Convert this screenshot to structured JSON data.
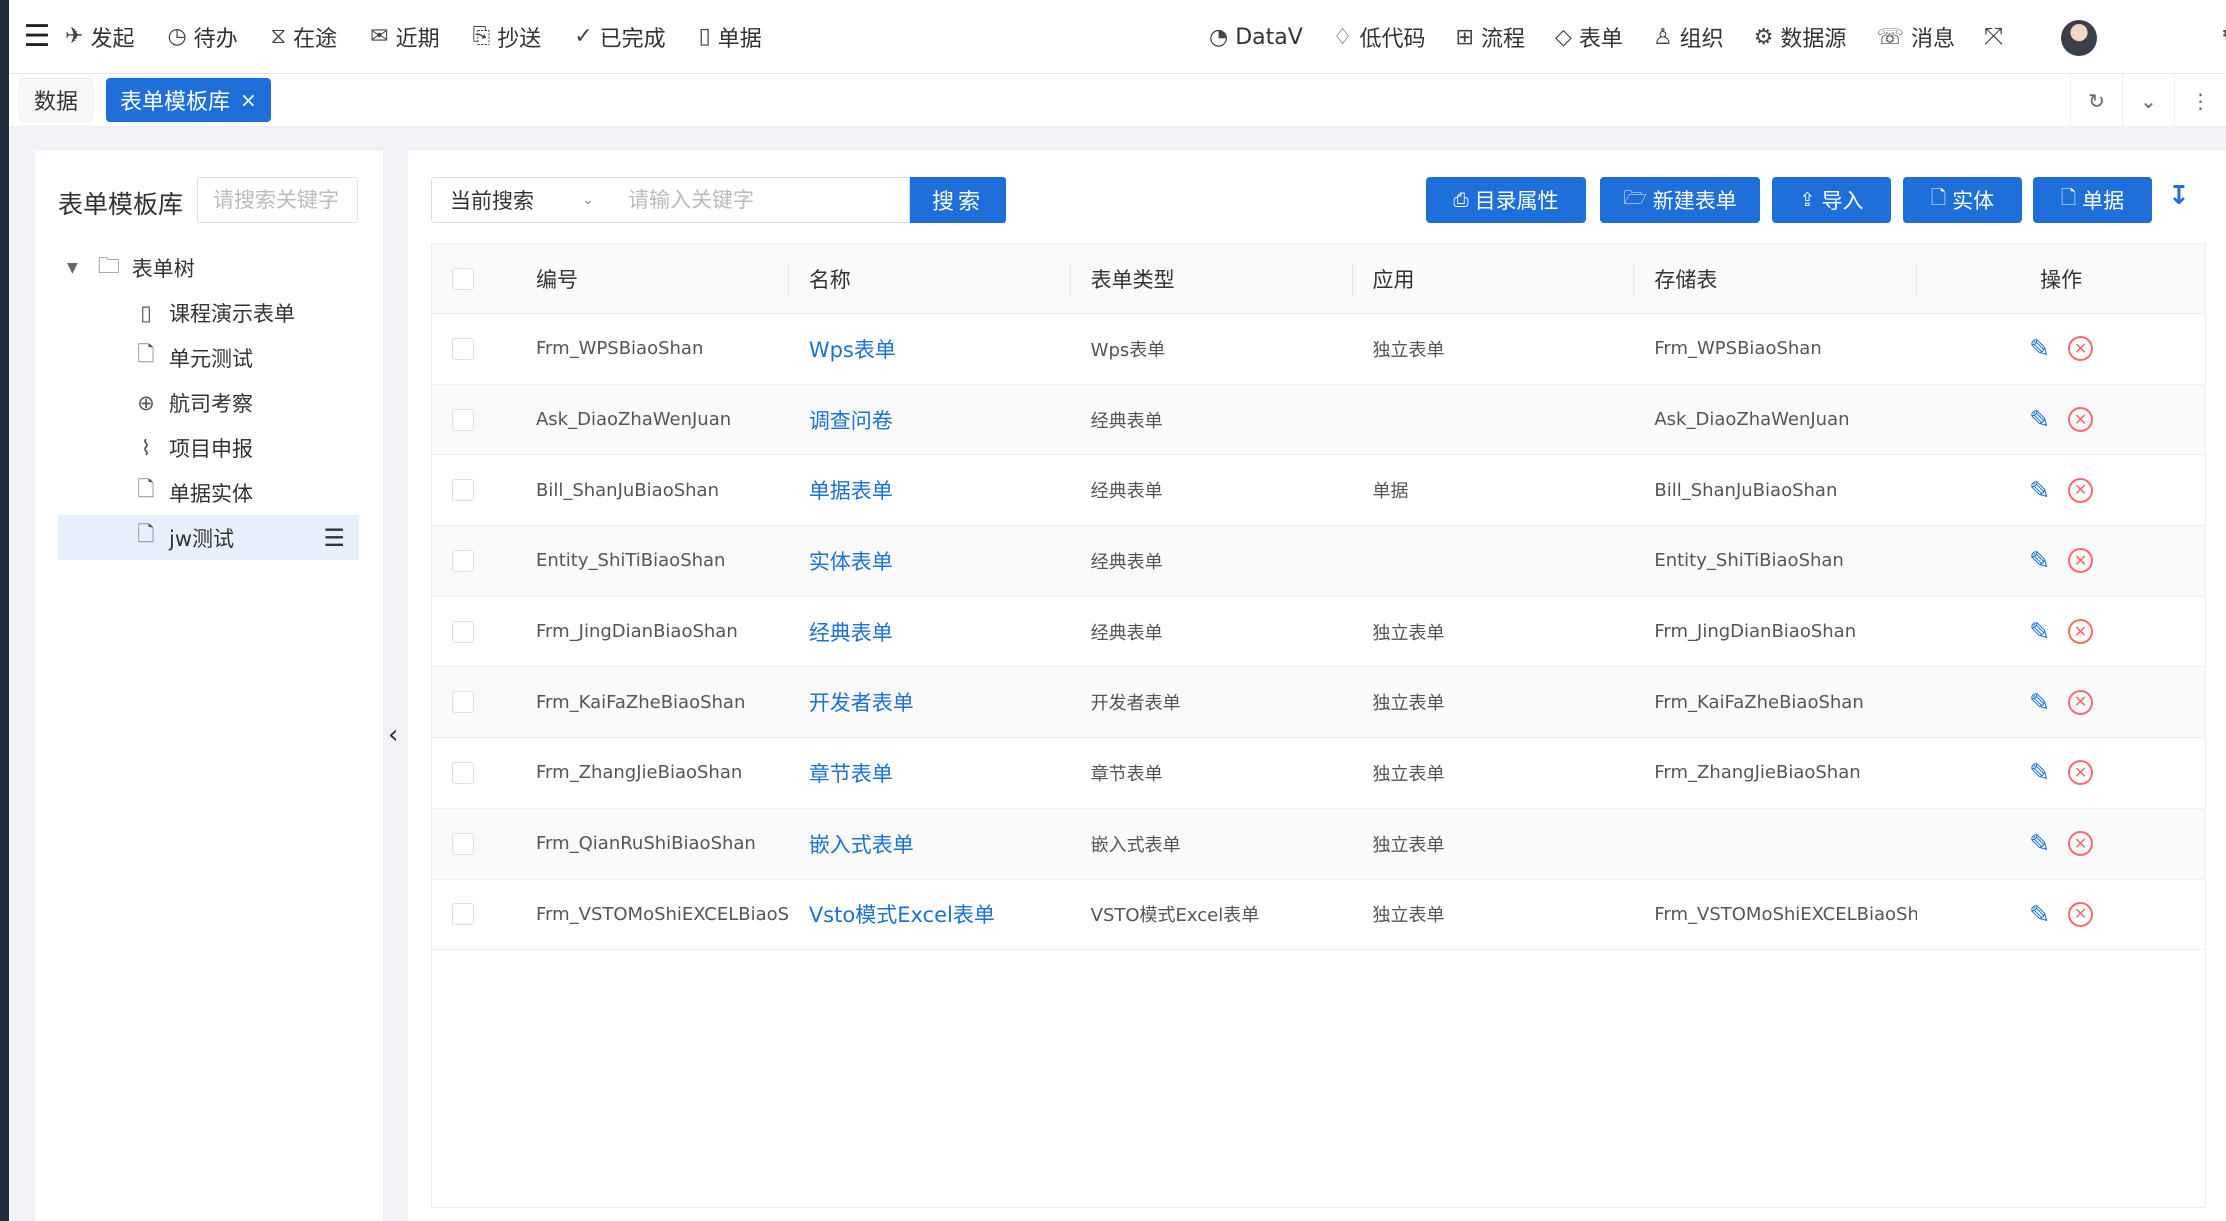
{
  "topnav": {
    "left": [
      {
        "icon": "send-icon",
        "glyph": "✈",
        "label": "发起"
      },
      {
        "icon": "clock-icon",
        "glyph": "◷",
        "label": "待办"
      },
      {
        "icon": "hourglass-icon",
        "glyph": "⧖",
        "label": "在途"
      },
      {
        "icon": "mail-icon",
        "glyph": "✉",
        "label": "近期"
      },
      {
        "icon": "clipboard-icon",
        "glyph": "⎘",
        "label": "抄送"
      },
      {
        "icon": "check-circle-icon",
        "glyph": "✓",
        "label": "已完成"
      },
      {
        "icon": "document-icon",
        "glyph": "▯",
        "label": "单据"
      }
    ],
    "right": [
      {
        "icon": "datav-icon",
        "glyph": "◔",
        "label": "DataV"
      },
      {
        "icon": "lowcode-icon",
        "glyph": "♢",
        "label": "低代码"
      },
      {
        "icon": "flow-icon",
        "glyph": "⊞",
        "label": "流程"
      },
      {
        "icon": "diamond-icon",
        "glyph": "◇",
        "label": "表单"
      },
      {
        "icon": "org-icon",
        "glyph": "♙",
        "label": "组织"
      },
      {
        "icon": "gear-icon",
        "glyph": "⚙",
        "label": "数据源"
      },
      {
        "icon": "message-icon",
        "glyph": "☏",
        "label": "消息"
      }
    ]
  },
  "tags": {
    "data": "数据",
    "active": "表单模板库",
    "close": "×"
  },
  "sidebar": {
    "title": "表单模板库",
    "search_placeholder": "请搜索关键字",
    "root": "表单树",
    "items": [
      {
        "icon": "mobile-icon",
        "glyph": "▯",
        "label": "课程演示表单"
      },
      {
        "icon": "file-icon",
        "glyph": "🗋",
        "label": "单元测试"
      },
      {
        "icon": "globe-icon",
        "glyph": "⊕",
        "label": "航司考察"
      },
      {
        "icon": "paperclip-icon",
        "glyph": "⌇",
        "label": "项目申报"
      },
      {
        "icon": "file-icon",
        "glyph": "🗋",
        "label": "单据实体"
      },
      {
        "icon": "file-icon",
        "glyph": "🗋",
        "label": "jw测试"
      }
    ]
  },
  "toolbar": {
    "search_scope": "当前搜索",
    "search_placeholder": "请输入关键字",
    "search_button": "搜索",
    "buttons": [
      {
        "icon": "catalog-icon",
        "glyph": "⎙",
        "label": "目录属性"
      },
      {
        "icon": "folder-open-icon",
        "glyph": "🗁",
        "label": "新建表单"
      },
      {
        "icon": "upload-icon",
        "glyph": "⇪",
        "label": "导入"
      },
      {
        "icon": "file-icon",
        "glyph": "🗋",
        "label": "实体"
      },
      {
        "icon": "file-icon",
        "glyph": "🗋",
        "label": "单据"
      }
    ]
  },
  "table": {
    "headers": [
      "编号",
      "名称",
      "表单类型",
      "应用",
      "存储表",
      "操作"
    ],
    "rows": [
      {
        "no": "Frm_WPSBiaoShan",
        "name": "Wps表单",
        "type": "Wps表单",
        "app": "独立表单",
        "store": "Frm_WPSBiaoShan"
      },
      {
        "no": "Ask_DiaoZhaWenJuan",
        "name": "调查问卷",
        "type": "经典表单",
        "app": "",
        "store": "Ask_DiaoZhaWenJuan"
      },
      {
        "no": "Bill_ShanJuBiaoShan",
        "name": "单据表单",
        "type": "经典表单",
        "app": "单据",
        "store": "Bill_ShanJuBiaoShan"
      },
      {
        "no": "Entity_ShiTiBiaoShan",
        "name": "实体表单",
        "type": "经典表单",
        "app": "",
        "store": "Entity_ShiTiBiaoShan"
      },
      {
        "no": "Frm_JingDianBiaoShan",
        "name": "经典表单",
        "type": "经典表单",
        "app": "独立表单",
        "store": "Frm_JingDianBiaoShan"
      },
      {
        "no": "Frm_KaiFaZheBiaoShan",
        "name": "开发者表单",
        "type": "开发者表单",
        "app": "独立表单",
        "store": "Frm_KaiFaZheBiaoShan"
      },
      {
        "no": "Frm_ZhangJieBiaoShan",
        "name": "章节表单",
        "type": "章节表单",
        "app": "独立表单",
        "store": "Frm_ZhangJieBiaoShan"
      },
      {
        "no": "Frm_QianRuShiBiaoShan",
        "name": "嵌入式表单",
        "type": "嵌入式表单",
        "app": "独立表单",
        "store": ""
      },
      {
        "no": "Frm_VSTOMoShiEXCELBiaoSh",
        "name": "Vsto模式Excel表单",
        "type": "VSTO模式Excel表单",
        "app": "独立表单",
        "store": "Frm_VSTOMoShiEXCELBiaoSh"
      }
    ]
  },
  "colors": {
    "primary": "#1e6fd9",
    "danger": "#f56c6c"
  }
}
